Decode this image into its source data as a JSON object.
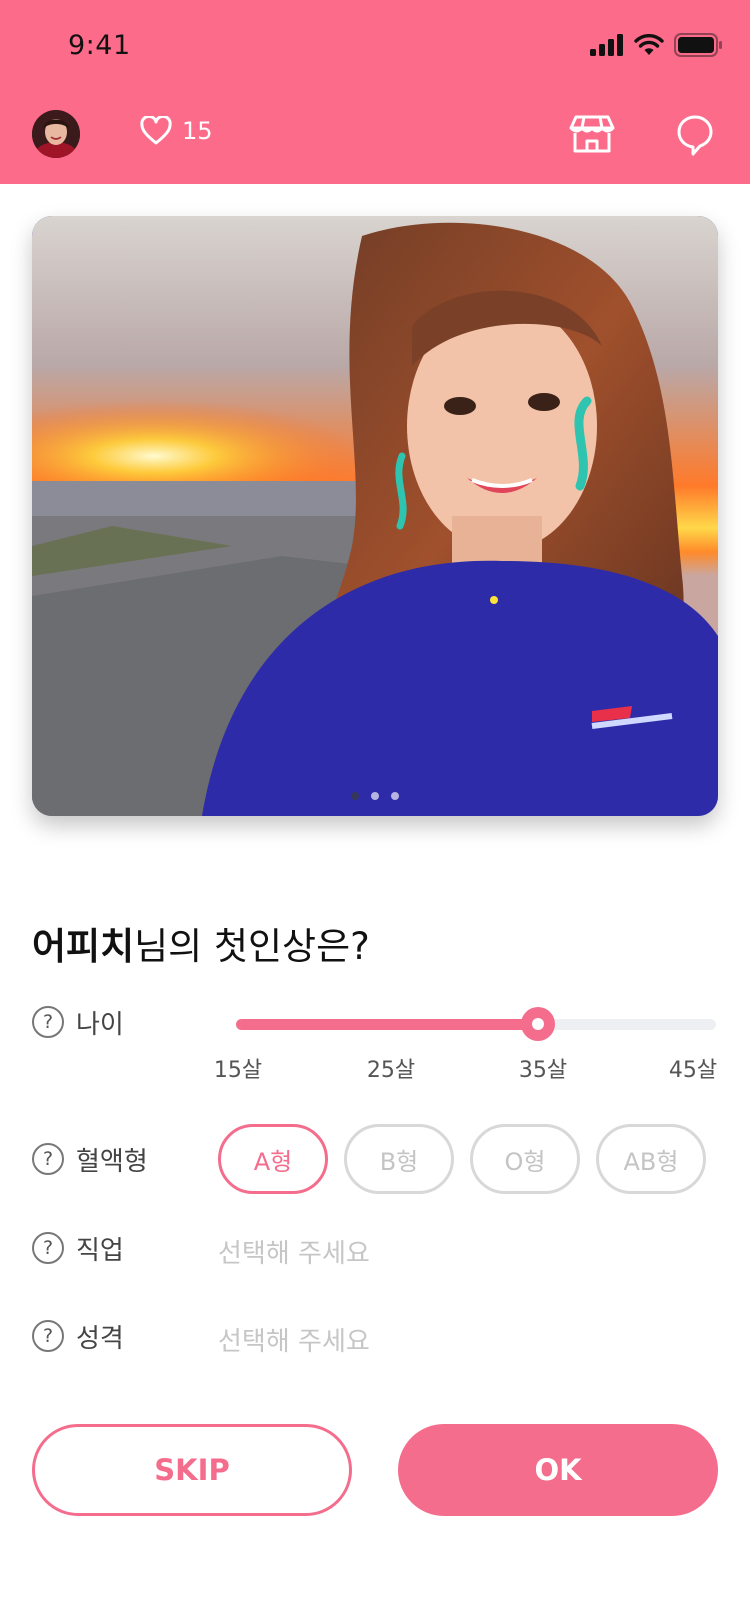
{
  "status_bar": {
    "time": "9:41"
  },
  "header": {
    "likes_count": "15",
    "icons": {
      "likes": "heart-icon",
      "store": "store-icon",
      "chat": "chat-bubble-icon"
    }
  },
  "photo": {
    "description_icon": "profile-photo",
    "pages": 3,
    "active_page": 1
  },
  "question": {
    "name": "어피치",
    "suffix": "님의 첫인상은?"
  },
  "age": {
    "label": "나이",
    "ticks": [
      "15살",
      "25살",
      "35살",
      "45살"
    ],
    "value_fraction": 0.63
  },
  "blood": {
    "label": "혈액형",
    "options": [
      "A형",
      "B형",
      "O형",
      "AB형"
    ],
    "selected": "A형"
  },
  "job": {
    "label": "직업",
    "placeholder": "선택해 주세요"
  },
  "personality": {
    "label": "성격",
    "placeholder": "선택해 주세요"
  },
  "buttons": {
    "skip": "SKIP",
    "ok": "OK"
  },
  "colors": {
    "brand": "#fd6b8b",
    "accent": "#f46d8c",
    "muted": "#c6c6c6"
  }
}
